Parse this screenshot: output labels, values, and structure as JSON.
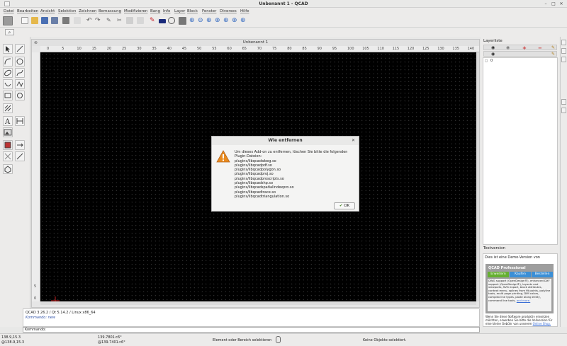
{
  "window": {
    "title": "Unbenannt 1 - QCAD"
  },
  "menu": [
    "Datei",
    "Bearbeiten",
    "Ansicht",
    "Selektion",
    "Zeichnen",
    "Bemassung",
    "Modifizieren",
    "Bang",
    "Info",
    "Layer",
    "Block",
    "Fenster",
    "Diverses",
    "Hilfe"
  ],
  "document": {
    "tab_title": "Unbenannt 1"
  },
  "ruler": {
    "h_ticks": [
      "0",
      "5",
      "10",
      "15",
      "20",
      "25",
      "30",
      "35",
      "40",
      "45",
      "50",
      "55",
      "60",
      "65",
      "70",
      "75",
      "80",
      "85",
      "90",
      "95",
      "100",
      "105",
      "110",
      "115",
      "120",
      "125",
      "130",
      "135",
      "140"
    ],
    "v_ticks": [
      "5",
      "0"
    ]
  },
  "command": {
    "history_line1": "QCAD 3.26.2 / Qt 5.14.2 / Linux x86_64",
    "history_line2": "Kommando: new",
    "prompt_label": "Kommando:"
  },
  "status": {
    "abs_coord": "138.9,15.3",
    "rel_coord": "@138.9,15.3",
    "polar_coord": "139.7801<6°",
    "polar_rel": "@139.7401<6°",
    "hint": "Element oder Bereich selektieren",
    "selection": "Keine Objekte selektiert."
  },
  "layer_panel": {
    "title": "Layerliste",
    "layer_name": "0"
  },
  "demo_panel": {
    "title": "Testversion",
    "intro": "Dies ist eine Demo-Version von",
    "product": "QCAD Professional",
    "tabs": [
      "Erweitern",
      "Kaufen",
      "Bestellen"
    ],
    "features": "DWG support (OpenDesign®), enhanced DXF support (OpenDesign®), layouts and viewports, SVG export, block attributes, context menu, splines from fit points, polyline tools, multi page printing, DIM colors, complex line types, paste along entity, command line tools,",
    "features_more": "and more.",
    "footer": "Wenn Sie diese Software produktiv einsetzen möchten, erwerben Sie bitte die Vollversion für eine kleine Gebühr von unserem",
    "footer_link": "Online Shop."
  },
  "dialog": {
    "title": "Wie entfernen",
    "message": "Um dieses Add-on zu entfernen, löschen Sie bitte die folgenden Plugin-Dateien:",
    "files": [
      "plugins/libqcadwbeg.so",
      "plugins/libqcadpdf.so",
      "plugins/libqcadpolygon.so",
      "plugins/libqcadproj.so",
      "plugins/libqcadproscripts.so",
      "plugins/libqcadshp.so",
      "plugins/libqcadspatialindexpro.so",
      "plugins/libqcadtrace.so",
      "plugins/libqcadtriangulation.so"
    ],
    "ok_label": "OK"
  },
  "colors": {
    "canvas": "#000000",
    "demo_green": "#66b032",
    "demo_blue": "#3b8fd6",
    "warning": "#e88a1e"
  }
}
